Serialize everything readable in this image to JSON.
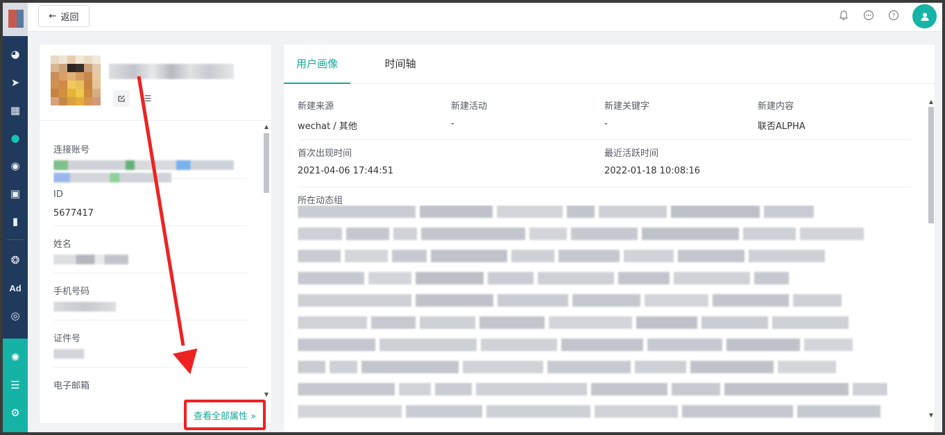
{
  "topbar": {
    "back_label": "返回",
    "icons": [
      "bell-icon",
      "chat-icon",
      "help-icon",
      "user-avatar-icon"
    ]
  },
  "sidebar": {
    "icons": [
      "dashboard-icon",
      "send-icon",
      "layout-icon",
      "user-icon",
      "users-icon",
      "bookmark-user-icon",
      "bar-chart-icon",
      "wechat-icon",
      "ad-icon",
      "target-icon",
      "network-icon",
      "server-icon",
      "settings-icon"
    ],
    "ad_label": "Ad"
  },
  "profile": {
    "fields": [
      {
        "label": "连接账号",
        "value": ""
      },
      {
        "label": "ID",
        "value": "5677417"
      },
      {
        "label": "姓名",
        "value": ""
      },
      {
        "label": "手机号码",
        "value": ""
      },
      {
        "label": "证件号",
        "value": ""
      },
      {
        "label": "电子邮箱",
        "value": ""
      }
    ],
    "view_all_label": "查看全部属性 »"
  },
  "tabs": [
    {
      "label": "用户画像",
      "active": true
    },
    {
      "label": "时间轴",
      "active": false
    }
  ],
  "info": {
    "row1": [
      {
        "label": "新建来源",
        "value": "wechat / 其他"
      },
      {
        "label": "新建活动",
        "value": "-"
      },
      {
        "label": "新建关键字",
        "value": "-"
      },
      {
        "label": "新建内容",
        "value": "联否ALPHA"
      }
    ],
    "row2": [
      {
        "label": "首次出现时间",
        "value": "2021-04-06 17:44:51"
      },
      {
        "label": "最近活跃时间",
        "value": "2022-01-18 10:08:16"
      }
    ],
    "group_label": "所在动态组"
  },
  "colors": {
    "accent": "#16a89a",
    "sidebar": "#1f3a5c",
    "highlight": "#ee2222"
  }
}
